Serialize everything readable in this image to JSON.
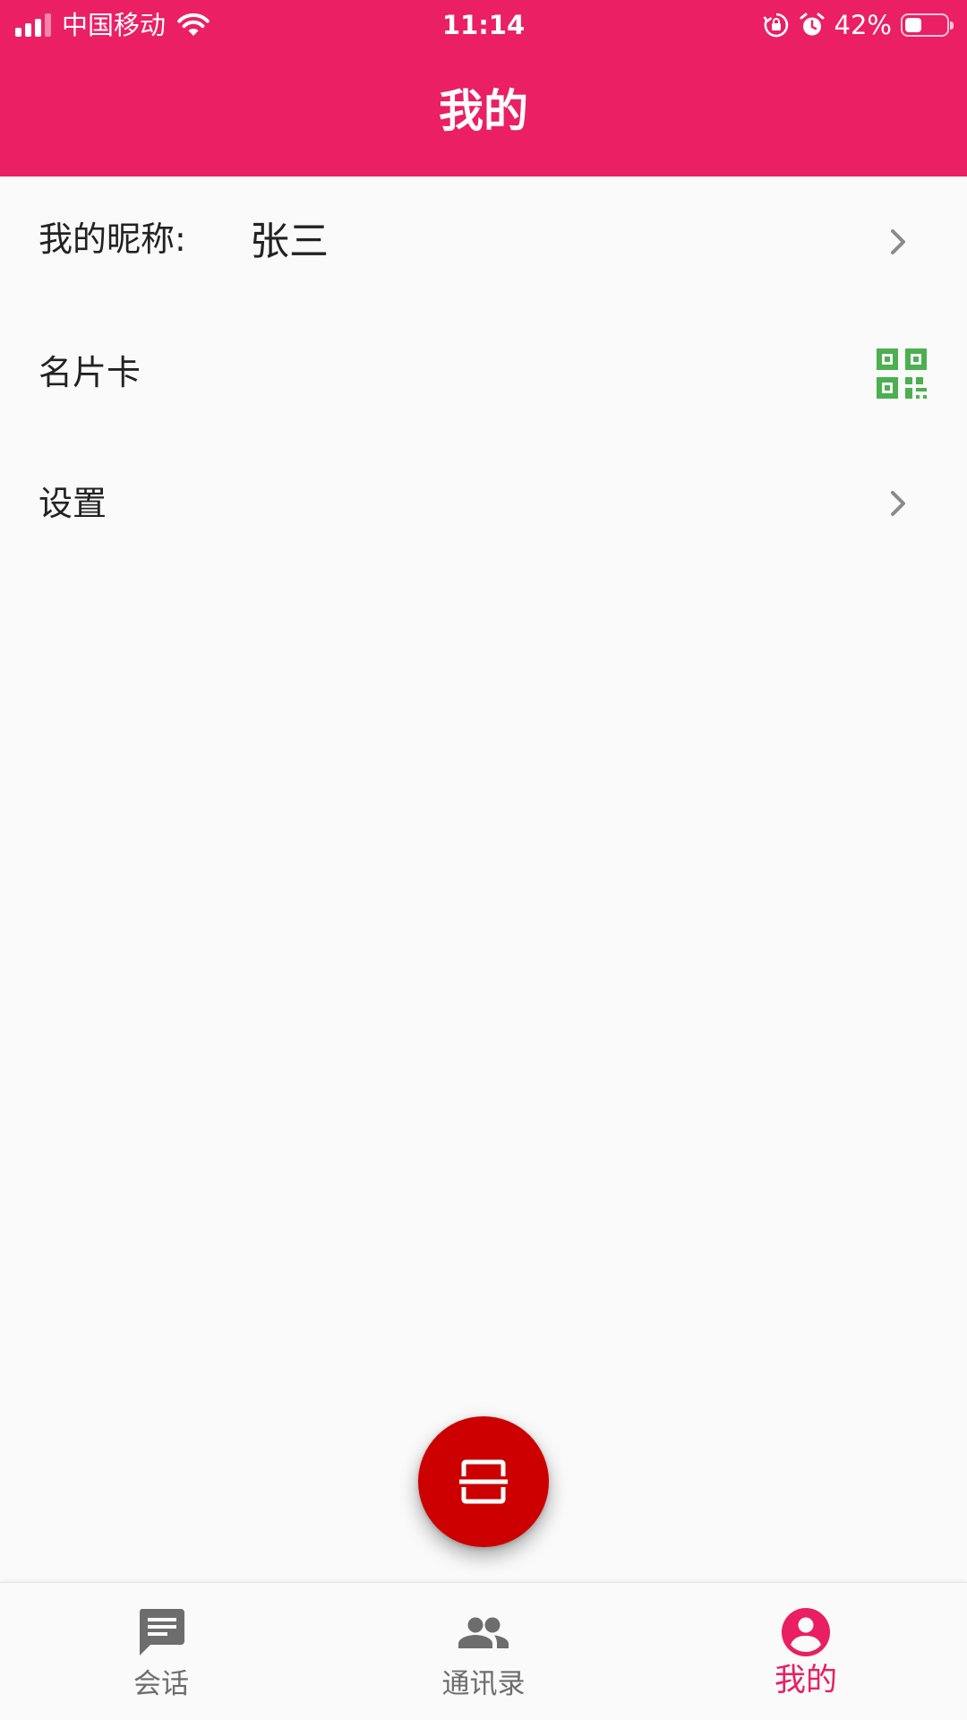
{
  "colors": {
    "primary": "#eb1f64",
    "active_tab": "#e91e63",
    "fab": "#cc0000",
    "qr_icon": "#4caf50",
    "inactive_tab": "#6d6d6d",
    "background": "#fafafa"
  },
  "status_bar": {
    "carrier": "中国移动",
    "time": "11:14",
    "battery": "42%",
    "battery_level": 0.42,
    "icons": [
      "signal-icon",
      "wifi-icon",
      "orientation-lock-icon",
      "alarm-icon",
      "battery-icon"
    ]
  },
  "header": {
    "title": "我的"
  },
  "profile_list": {
    "nickname": {
      "label": "我的昵称:",
      "value": "张三",
      "icon": "chevron-right-icon"
    },
    "business_card": {
      "label": "名片卡",
      "icon": "qr-code-icon"
    },
    "settings": {
      "label": "设置",
      "icon": "chevron-right-icon"
    }
  },
  "fab": {
    "icon": "scan-icon"
  },
  "bottom_nav": {
    "items": [
      {
        "label": "会话",
        "icon": "chat-icon",
        "active": false
      },
      {
        "label": "通讯录",
        "icon": "contacts-icon",
        "active": false
      },
      {
        "label": "我的",
        "icon": "account-circle-icon",
        "active": true
      }
    ]
  }
}
